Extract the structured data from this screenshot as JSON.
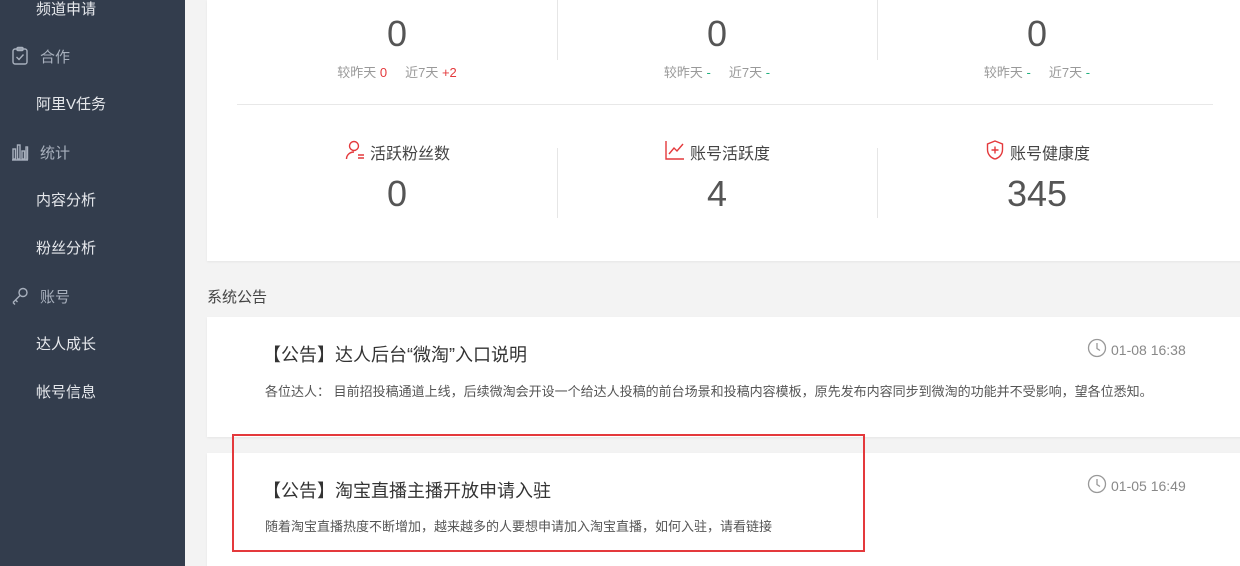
{
  "sidebar": {
    "items": [
      {
        "type": "sub",
        "label": "频道申请"
      },
      {
        "type": "group",
        "label": "合作",
        "icon": "clipboard-check-icon"
      },
      {
        "type": "sub",
        "label": "阿里V任务"
      },
      {
        "type": "group",
        "label": "统计",
        "icon": "bar-chart-icon"
      },
      {
        "type": "sub",
        "label": "内容分析"
      },
      {
        "type": "sub",
        "label": "粉丝分析"
      },
      {
        "type": "group",
        "label": "账号",
        "icon": "key-icon"
      },
      {
        "type": "sub",
        "label": "达人成长"
      },
      {
        "type": "sub",
        "label": "帐号信息"
      }
    ]
  },
  "stats": {
    "top": [
      {
        "value": "0",
        "yesterday_label": "较昨天",
        "yesterday_value": "0",
        "week_label": "近7天",
        "week_value": "+2"
      },
      {
        "value": "0",
        "yesterday_label": "较昨天",
        "yesterday_value": "-",
        "week_label": "近7天",
        "week_value": "-"
      },
      {
        "value": "0",
        "yesterday_label": "较昨天",
        "yesterday_value": "-",
        "week_label": "近7天",
        "week_value": "-"
      }
    ],
    "metrics": [
      {
        "title": "活跃粉丝数",
        "value": "0",
        "icon": "user-icon"
      },
      {
        "title": "账号活跃度",
        "value": "4",
        "icon": "line-chart-icon"
      },
      {
        "title": "账号健康度",
        "value": "345",
        "icon": "shield-plus-icon"
      }
    ]
  },
  "announcements": {
    "section_title": "系统公告",
    "items": [
      {
        "title": "【公告】达人后台“微淘”入口说明",
        "time": "01-08 16:38",
        "summary": "各位达人： 目前招投稿通道上线，后续微淘会开设一个给达人投稿的前台场景和投稿内容模板，原先发布内容同步到微淘的功能并不受影响，望各位悉知。"
      },
      {
        "title": "【公告】淘宝直播主播开放申请入驻",
        "time": "01-05 16:49",
        "summary": "随着淘宝直播热度不断增加，越来越多的人要想申请加入淘宝直播，如何入驻，请看链接"
      }
    ]
  },
  "colors": {
    "sidebar_bg": "#333d4d",
    "accent_red": "#e4393c",
    "accent_green": "#22b07d",
    "highlight": "#e4393c"
  }
}
